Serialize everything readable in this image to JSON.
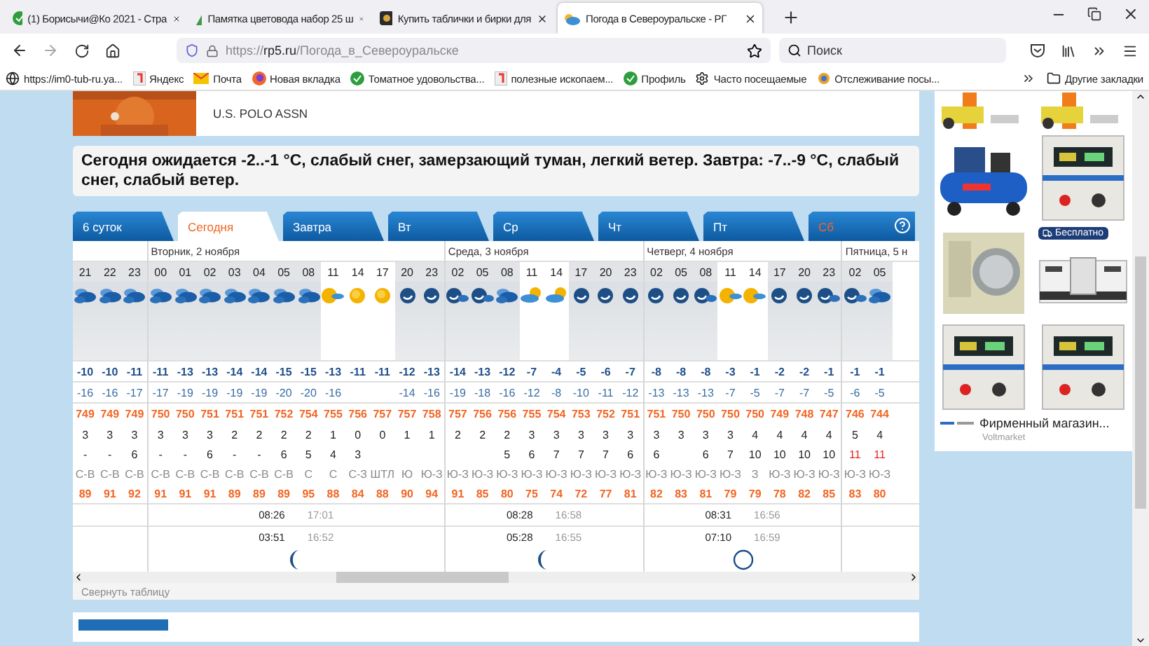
{
  "browser": {
    "tabs": [
      {
        "title": "(1) Борисычи@Ко 2021 - Стра",
        "selected": false
      },
      {
        "title": "Памятка цветовода набор 25 ш",
        "selected": false
      },
      {
        "title": "Купить таблички и бирки для",
        "selected": false
      },
      {
        "title": "Погода в Североуральске - РГ",
        "selected": true
      }
    ],
    "address": {
      "scheme": "https://",
      "host": "rp5.ru",
      "path": "/Погода_в_Североуральске"
    },
    "search": {
      "placeholder": "Поиск"
    },
    "bookmarks": [
      {
        "label": "https://im0-tub-ru.ya..."
      },
      {
        "label": "Яндекс"
      },
      {
        "label": "Почта"
      },
      {
        "label": "Новая вкладка"
      },
      {
        "label": "Томатное удовольства..."
      },
      {
        "label": "полезные ископаем..."
      },
      {
        "label": "Профиль"
      },
      {
        "label": "Часто посещаемые"
      },
      {
        "label": "Отслеживание посы..."
      }
    ],
    "other_bookmarks": "Другие закладки"
  },
  "banner": {
    "brand": "U.S. POLO ASSN"
  },
  "summary": "Сегодня ожидается -2..-1 °C, слабый снег, замерзающий туман, легкий ветер. Завтра: -7..-9 °C, слабый снег, слабый ветер.",
  "tabs": [
    {
      "label": "6 суток",
      "selected": false,
      "weekend": false
    },
    {
      "label": "Сегодня",
      "selected": true,
      "weekend": false
    },
    {
      "label": "Завтра",
      "selected": false,
      "weekend": false
    },
    {
      "label": "Вт",
      "selected": false,
      "weekend": false
    },
    {
      "label": "Ср",
      "selected": false,
      "weekend": false
    },
    {
      "label": "Чт",
      "selected": false,
      "weekend": false
    },
    {
      "label": "Пт",
      "selected": false,
      "weekend": false
    },
    {
      "label": "Сб",
      "selected": false,
      "weekend": true
    }
  ],
  "table": {
    "days": [
      {
        "columns": [
          {
            "hour": "21",
            "kind": "snow-cloud",
            "temp": "-10",
            "feels": "-16",
            "pressure": "749",
            "wind": "3",
            "gust": "-",
            "dir": "С-В",
            "humidity": "89",
            "daylight": false
          },
          {
            "hour": "22",
            "kind": "snow-cloud",
            "temp": "-10",
            "feels": "-16",
            "pressure": "749",
            "wind": "3",
            "gust": "-",
            "dir": "С-В",
            "humidity": "91",
            "daylight": false
          },
          {
            "hour": "23",
            "kind": "snow-cloud",
            "temp": "-11",
            "feels": "-17",
            "pressure": "749",
            "wind": "3",
            "gust": "6",
            "dir": "С-В",
            "humidity": "92",
            "daylight": false
          }
        ]
      },
      {
        "date": "Вторник, 2 ноября",
        "sunrise": "08:26",
        "sunset": "17:01",
        "moonrise": "03:51",
        "moonset": "16:52",
        "moon": {
          "kind": "crescent"
        },
        "columns": [
          {
            "hour": "00",
            "kind": "snow-cloud",
            "temp": "-11",
            "feels": "-17",
            "pressure": "750",
            "wind": "3",
            "gust": "-",
            "dir": "С-В",
            "humidity": "91",
            "daylight": false
          },
          {
            "hour": "01",
            "kind": "snow-cloud",
            "temp": "-13",
            "feels": "-19",
            "pressure": "750",
            "wind": "3",
            "gust": "-",
            "dir": "С-В",
            "humidity": "91",
            "daylight": false
          },
          {
            "hour": "02",
            "kind": "snow-cloud",
            "temp": "-13",
            "feels": "-19",
            "pressure": "751",
            "wind": "3",
            "gust": "6",
            "dir": "С-В",
            "humidity": "91",
            "daylight": false
          },
          {
            "hour": "03",
            "kind": "snow-cloud",
            "temp": "-14",
            "feels": "-19",
            "pressure": "751",
            "wind": "2",
            "gust": "-",
            "dir": "С-В",
            "humidity": "89",
            "daylight": false
          },
          {
            "hour": "04",
            "kind": "snow-cloud",
            "temp": "-14",
            "feels": "-19",
            "pressure": "751",
            "wind": "2",
            "gust": "-",
            "dir": "С-В",
            "humidity": "89",
            "daylight": false
          },
          {
            "hour": "05",
            "kind": "snow-cloud",
            "temp": "-15",
            "feels": "-20",
            "pressure": "752",
            "wind": "2",
            "gust": "6",
            "dir": "С-В",
            "humidity": "89",
            "daylight": false
          },
          {
            "hour": "08",
            "kind": "snow-cloud",
            "temp": "-15",
            "feels": "-20",
            "pressure": "754",
            "wind": "2",
            "gust": "5",
            "dir": "С",
            "humidity": "95",
            "daylight": false
          },
          {
            "hour": "11",
            "kind": "sun-cloud",
            "temp": "-13",
            "feels": "-16",
            "pressure": "755",
            "wind": "1",
            "gust": "4",
            "dir": "С",
            "humidity": "88",
            "daylight": true
          },
          {
            "hour": "14",
            "kind": "sun",
            "temp": "-11",
            "pressure": "756",
            "wind": "0",
            "gust": "3",
            "dir": "С-З",
            "humidity": "84",
            "daylight": true
          },
          {
            "hour": "17",
            "kind": "sun",
            "temp": "-11",
            "pressure": "757",
            "wind": "0",
            "dir": "ШТЛ",
            "humidity": "88",
            "daylight": true
          },
          {
            "hour": "20",
            "kind": "moon",
            "temp": "-12",
            "feels": "-14",
            "pressure": "757",
            "wind": "1",
            "dir": "Ю",
            "humidity": "90",
            "daylight": false
          },
          {
            "hour": "23",
            "kind": "moon",
            "temp": "-13",
            "feels": "-16",
            "pressure": "758",
            "wind": "1",
            "dir": "Ю-З",
            "humidity": "94",
            "daylight": false
          }
        ]
      },
      {
        "date": "Среда, 3 ноября",
        "sunrise": "08:28",
        "sunset": "16:58",
        "moonrise": "05:28",
        "moonset": "16:55",
        "moon": {
          "kind": "crescent"
        },
        "columns": [
          {
            "hour": "02",
            "kind": "moon-cloud",
            "temp": "-14",
            "feels": "-19",
            "pressure": "757",
            "wind": "2",
            "dir": "Ю-З",
            "humidity": "91",
            "daylight": false
          },
          {
            "hour": "05",
            "kind": "moon-cloud",
            "temp": "-13",
            "feels": "-18",
            "pressure": "756",
            "wind": "2",
            "dir": "Ю-З",
            "humidity": "85",
            "daylight": false
          },
          {
            "hour": "08",
            "kind": "snow-cloud",
            "temp": "-12",
            "feels": "-16",
            "pressure": "756",
            "wind": "2",
            "gust": "5",
            "dir": "Ю-З",
            "humidity": "80",
            "daylight": false
          },
          {
            "hour": "11",
            "kind": "cloud-sun",
            "temp": "-7",
            "feels": "-12",
            "pressure": "755",
            "wind": "3",
            "gust": "6",
            "dir": "Ю-З",
            "humidity": "75",
            "daylight": true
          },
          {
            "hour": "14",
            "kind": "cloud-sun",
            "temp": "-4",
            "feels": "-8",
            "pressure": "754",
            "wind": "3",
            "gust": "7",
            "dir": "Ю-З",
            "humidity": "74",
            "daylight": true
          },
          {
            "hour": "17",
            "kind": "moon",
            "temp": "-5",
            "feels": "-10",
            "pressure": "753",
            "wind": "3",
            "gust": "7",
            "dir": "Ю-З",
            "humidity": "72",
            "daylight": false
          },
          {
            "hour": "20",
            "kind": "moon",
            "temp": "-6",
            "feels": "-11",
            "pressure": "752",
            "wind": "3",
            "gust": "7",
            "dir": "Ю-З",
            "humidity": "77",
            "daylight": false
          },
          {
            "hour": "23",
            "kind": "moon",
            "temp": "-7",
            "feels": "-12",
            "pressure": "751",
            "wind": "3",
            "gust": "6",
            "dir": "Ю-З",
            "humidity": "81",
            "daylight": false
          }
        ]
      },
      {
        "date": "Четверг, 4 ноября",
        "sunrise": "08:31",
        "sunset": "16:56",
        "moonrise": "07:10",
        "moonset": "16:59",
        "moon": {
          "kind": "new"
        },
        "columns": [
          {
            "hour": "02",
            "kind": "moon",
            "temp": "-8",
            "feels": "-13",
            "pressure": "751",
            "wind": "3",
            "gust": "6",
            "dir": "Ю-З",
            "humidity": "82",
            "daylight": false
          },
          {
            "hour": "05",
            "kind": "moon",
            "temp": "-8",
            "feels": "-13",
            "pressure": "750",
            "wind": "3",
            "dir": "Ю-З",
            "humidity": "83",
            "daylight": false
          },
          {
            "hour": "08",
            "kind": "moon-cloud",
            "temp": "-8",
            "feels": "-13",
            "pressure": "750",
            "wind": "3",
            "gust": "6",
            "dir": "Ю-З",
            "humidity": "81",
            "daylight": false
          },
          {
            "hour": "11",
            "kind": "sun-cloud",
            "temp": "-3",
            "feels": "-7",
            "pressure": "750",
            "wind": "3",
            "gust": "7",
            "dir": "Ю-З",
            "humidity": "79",
            "daylight": true
          },
          {
            "hour": "14",
            "kind": "sun-cloud",
            "temp": "-1",
            "feels": "-5",
            "pressure": "750",
            "wind": "4",
            "gust": "10",
            "dir": "З",
            "humidity": "79",
            "daylight": true
          },
          {
            "hour": "17",
            "kind": "moon",
            "temp": "-2",
            "feels": "-7",
            "pressure": "749",
            "wind": "4",
            "gust": "10",
            "dir": "Ю-З",
            "humidity": "78",
            "daylight": false
          },
          {
            "hour": "20",
            "kind": "moon",
            "temp": "-2",
            "feels": "-7",
            "pressure": "748",
            "wind": "4",
            "gust": "10",
            "dir": "Ю-З",
            "humidity": "82",
            "daylight": false
          },
          {
            "hour": "23",
            "kind": "moon-cloud",
            "temp": "-1",
            "feels": "-5",
            "pressure": "747",
            "wind": "4",
            "gust": "10",
            "dir": "Ю-З",
            "humidity": "85",
            "daylight": false
          }
        ]
      },
      {
        "date": "Пятница, 5 н",
        "columns": [
          {
            "hour": "02",
            "kind": "moon-cloud",
            "temp": "-1",
            "feels": "-6",
            "pressure": "746",
            "wind": "5",
            "gust": "11",
            "dir": "Ю-З",
            "humidity": "83",
            "daylight": false
          },
          {
            "hour": "05",
            "kind": "snow-cloud",
            "temp": "-1",
            "feels": "-5",
            "pressure": "744",
            "wind": "4",
            "gust": "11",
            "dir": "Ю-З",
            "humidity": "80",
            "daylight": false
          }
        ]
      }
    ]
  },
  "collapse_label": "Свернуть таблицу",
  "ad": {
    "products": [
      {
        "kind": "tool"
      },
      {
        "kind": "tool"
      },
      {
        "kind": "compressor"
      },
      {
        "kind": "stabilizer"
      },
      {
        "kind": "relay"
      },
      {
        "kind": "switch",
        "badge": "Бесплатно"
      },
      {
        "kind": "stabilizer"
      },
      {
        "kind": "stabilizer"
      }
    ],
    "title": "Фирменный магазин...",
    "source": "Voltmarket"
  }
}
